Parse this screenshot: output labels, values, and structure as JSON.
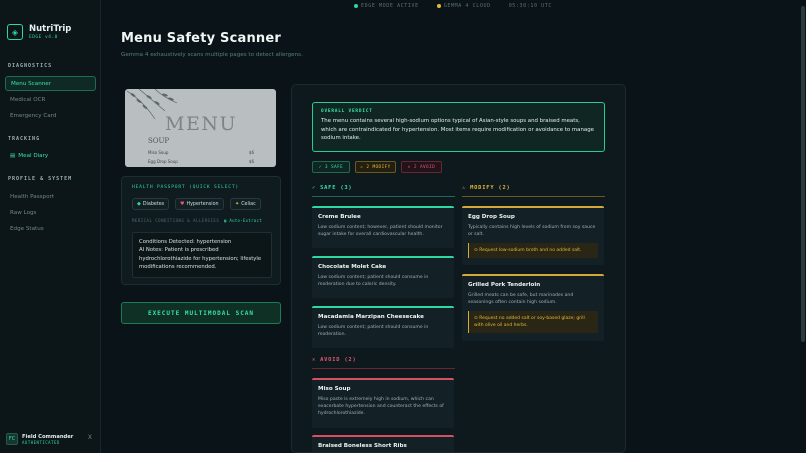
{
  "status_bar": {
    "edge_mode": "EDGE MODE ACTIVE",
    "model": "GEMMA 4 CLOUD",
    "time": "05:30:10 UTC"
  },
  "app": {
    "name": "NutriTrip",
    "version": "EDGE v4.0"
  },
  "sidebar": {
    "sections": {
      "diagnostics": "DIAGNOSTICS",
      "tracking": "TRACKING",
      "profile": "PROFILE & SYSTEM"
    },
    "items": {
      "menu_scanner": "Menu Scanner",
      "medical_ocr": "Medical OCR",
      "emergency_card": "Emergency Card",
      "meal_diary": "Meal Diary",
      "health_passport": "Health Passport",
      "raw_logs": "Raw Logs",
      "edge_status": "Edge Status"
    },
    "user": {
      "initials": "FC",
      "name": "Field Commander",
      "status": "AUTHENTICATED",
      "logout": "X"
    }
  },
  "header": {
    "title": "Menu Safety Scanner",
    "subtitle": "Gemma 4 exhaustively scans multiple pages to detect allergens."
  },
  "menu_image": {
    "heading": "MENU",
    "section": "SOUP",
    "lines": [
      {
        "item": "Miso Soup",
        "price": "$6"
      },
      {
        "item": "Egg Drop Soup",
        "price": "$6"
      }
    ]
  },
  "passport": {
    "title": "HEALTH PASSPORT (QUICK SELECT)",
    "chips": [
      "Diabetes",
      "Hypertension",
      "Celiac"
    ],
    "conditions_label": "MEDICAL CONDITIONS & ALLERGIES",
    "auto_extract": "Auto-Extract",
    "conditions_text": "Conditions Detected: hypertension\nAI Notes: Patient is prescribed hydrochlorothiazide for hypertension; lifestyle modifications recommended."
  },
  "execute_button": "EXECUTE MULTIMODAL SCAN",
  "verdict": {
    "title": "OVERALL VERDICT",
    "text": "The menu contains several high-sodium options typical of Asian-style soups and braised meats, which are contraindicated for hypertension. Most items require modification or avoidance to manage sodium intake."
  },
  "badges": {
    "safe": "✓ 3 SAFE",
    "modify": "⚠ 2 MODIFY",
    "avoid": "✕ 2 AVOID"
  },
  "columns": {
    "safe_heading": "✓ SAFE (3)",
    "modify_heading": "⚠ MODIFY (2)",
    "avoid_heading": "✕ AVOID (2)"
  },
  "safe_items": [
    {
      "name": "Creme Brulee",
      "desc": "Low sodium content; however, patient should monitor sugar intake for overall cardiovascular health."
    },
    {
      "name": "Chocolate Molet Cake",
      "desc": "Low sodium content; patient should consume in moderation due to caloric density."
    },
    {
      "name": "Macadamia Marzipan Cheesecake",
      "desc": "Low sodium content; patient should consume in moderation."
    }
  ],
  "modify_items": [
    {
      "name": "Egg Drop Soup",
      "desc": "Typically contains high levels of sodium from soy sauce or salt.",
      "tip": "⊙ Request low-sodium broth and no added salt."
    },
    {
      "name": "Grilled Pork Tenderloin",
      "desc": "Grilled meats can be safe, but marinades and seasonings often contain high sodium.",
      "tip": "⊙ Request no added salt or soy-based glaze; grill with olive oil and herbs."
    }
  ],
  "avoid_items": [
    {
      "name": "Miso Soup",
      "desc": "Miso paste is extremely high in sodium, which can exacerbate hypertension and counteract the effects of hydrochlorothiazide."
    },
    {
      "name": "Braised Boneless Short Ribs",
      "desc": ""
    }
  ],
  "colors": {
    "accent": "#2fd8a0",
    "modify": "#d5a83a",
    "avoid": "#d64f63",
    "background": "#0a1317"
  }
}
